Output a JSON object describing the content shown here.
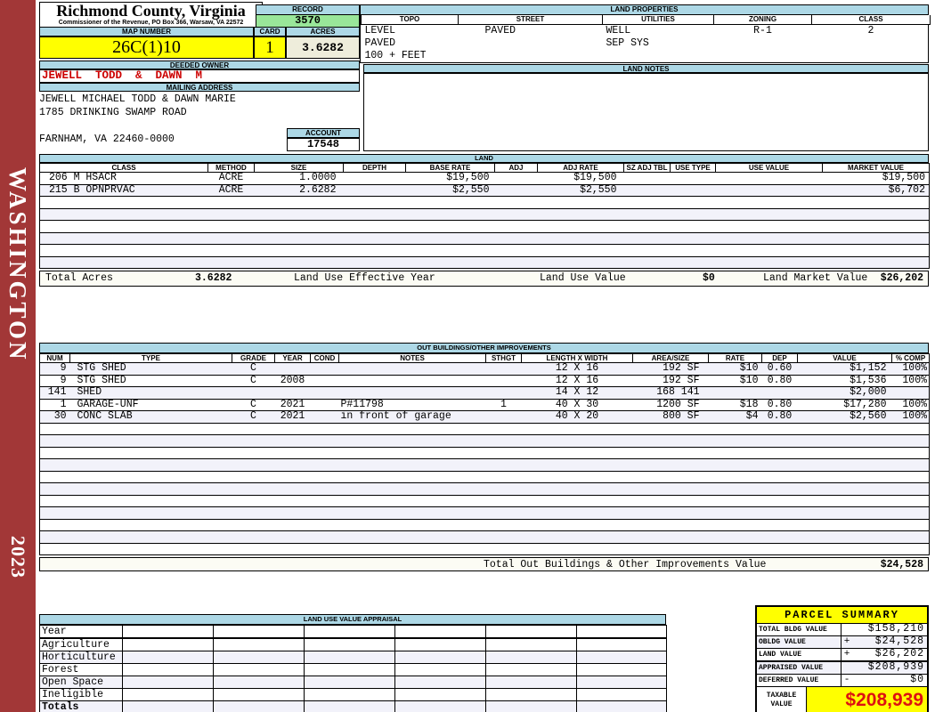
{
  "sidebar": {
    "district": "WASHINGTON",
    "year": "2023"
  },
  "header": {
    "county": "Richmond County, Virginia",
    "commissioner": "Commissioner of the Revenue, PO Box 366, Warsaw, VA 22572",
    "record_label": "RECORD",
    "record": "3570",
    "map_number_label": "MAP NUMBER",
    "map_number": "26C(1)10",
    "card_label": "CARD",
    "card": "1",
    "acres_label": "ACRES",
    "acres": "3.6282"
  },
  "land_properties": {
    "title": "LAND PROPERTIES",
    "columns": [
      "TOPO",
      "STREET",
      "UTILITIES",
      "ZONING",
      "CLASS"
    ],
    "rows": [
      [
        "LEVEL",
        "PAVED",
        "WELL",
        "R-1",
        "2"
      ],
      [
        "PAVED",
        "",
        "SEP SYS",
        "",
        ""
      ],
      [
        "100 + FEET",
        "",
        "",
        "",
        ""
      ]
    ]
  },
  "owner": {
    "deeded_owner_label": "DEEDED OWNER",
    "deeded_owner": "JEWELL  TODD  &  DAWN  M",
    "mailing_address_label": "MAILING ADDRESS",
    "address_lines": [
      "JEWELL MICHAEL TODD & DAWN MARIE",
      "1785 DRINKING SWAMP ROAD",
      "",
      "FARNHAM, VA 22460-0000"
    ],
    "account_label": "ACCOUNT",
    "account": "17548"
  },
  "land_notes": {
    "title": "LAND NOTES",
    "content": ""
  },
  "land": {
    "title": "LAND",
    "columns": [
      "CLASS",
      "METHOD",
      "SIZE",
      "DEPTH",
      "BASE RATE",
      "ADJ",
      "ADJ RATE",
      "SZ ADJ TBL",
      "USE TYPE",
      "USE VALUE",
      "MARKET VALUE"
    ],
    "rows": [
      [
        "206 M HSACR",
        "ACRE",
        "1.0000",
        "",
        "$19,500",
        "",
        "$19,500",
        "",
        "",
        "",
        "$19,500"
      ],
      [
        "215 B OPNPRVAC",
        "ACRE",
        "2.6282",
        "",
        "$2,550",
        "",
        "$2,550",
        "",
        "",
        "",
        "$6,702"
      ]
    ],
    "totals": {
      "total_acres_label": "Total Acres",
      "total_acres": "3.6282",
      "effective_year_label": "Land Use Effective Year",
      "use_value_label": "Land Use Value",
      "use_value": "$0",
      "market_value_label": "Land Market Value",
      "market_value": "$26,202"
    }
  },
  "out_buildings": {
    "title": "OUT BUILDINGS/OTHER IMPROVEMENTS",
    "columns": [
      "NUM",
      "TYPE",
      "GRADE",
      "YEAR",
      "COND",
      "NOTES",
      "STHGT",
      "LENGTH X WIDTH",
      "AREA/SIZE",
      "RATE",
      "DEP",
      "VALUE",
      "% COMP"
    ],
    "rows": [
      [
        "9",
        "STG SHED",
        "C",
        "",
        "",
        "",
        "",
        "12 X 16",
        "192 SF",
        "$10",
        "0.60",
        "$1,152",
        "100%"
      ],
      [
        "9",
        "STG SHED",
        "C",
        "2008",
        "",
        "",
        "",
        "12 X 16",
        "192 SF",
        "$10",
        "0.80",
        "$1,536",
        "100%"
      ],
      [
        "141",
        "SHED",
        "",
        "",
        "",
        "",
        "",
        "14 X 12",
        "168 141",
        "",
        "",
        "$2,000",
        ""
      ],
      [
        "1",
        "GARAGE-UNF",
        "C",
        "2021",
        "",
        "P#11798",
        "1",
        "40 X 30",
        "1200 SF",
        "$18",
        "0.80",
        "$17,280",
        "100%"
      ],
      [
        "30",
        "CONC SLAB",
        "C",
        "2021",
        "",
        "in front of garage",
        "",
        "40 X 20",
        "800 SF",
        "$4",
        "0.80",
        "$2,560",
        "100%"
      ]
    ],
    "total_label": "Total Out Buildings & Other Improvements Value",
    "total_value": "$24,528"
  },
  "land_use_appraisal": {
    "title": "LAND USE VALUE APPRAISAL",
    "rows": [
      [
        "Year",
        "",
        "",
        "",
        "",
        "",
        ""
      ],
      [
        "Agriculture",
        "",
        "",
        "",
        "",
        "",
        ""
      ],
      [
        "Horticulture",
        "",
        "",
        "",
        "",
        "",
        ""
      ],
      [
        "Forest",
        "",
        "",
        "",
        "",
        "",
        ""
      ],
      [
        "Open Space",
        "",
        "",
        "",
        "",
        "",
        ""
      ],
      [
        "Ineligible",
        "",
        "",
        "",
        "",
        "",
        ""
      ],
      [
        "Totals",
        "",
        "",
        "",
        "",
        "",
        ""
      ]
    ]
  },
  "parcel_summary": {
    "title": "PARCEL SUMMARY",
    "rows": [
      {
        "label": "TOTAL BLDG VALUE",
        "op": "",
        "value": "$158,210"
      },
      {
        "label": "OBLDG VALUE",
        "op": "+",
        "value": "$24,528"
      },
      {
        "label": "LAND VALUE",
        "op": "+",
        "value": "$26,202"
      },
      {
        "label": "APPRAISED VALUE",
        "op": "",
        "value": "$208,939"
      },
      {
        "label": "DEFERRED VALUE",
        "op": "-",
        "value": "$0"
      }
    ],
    "taxable_label": "TAXABLE VALUE",
    "taxable_value": "$208,939"
  },
  "colors": {
    "band_red": "#A23737",
    "owner_red": "#CC0000",
    "taxable_red": "#DD1111",
    "header_blue": "#ADD8E6",
    "highlight_yellow": "#FFFF00",
    "record_green": "#99E699",
    "acres_beige": "#EEEDDB",
    "row_tint": "#F2F2FA"
  }
}
